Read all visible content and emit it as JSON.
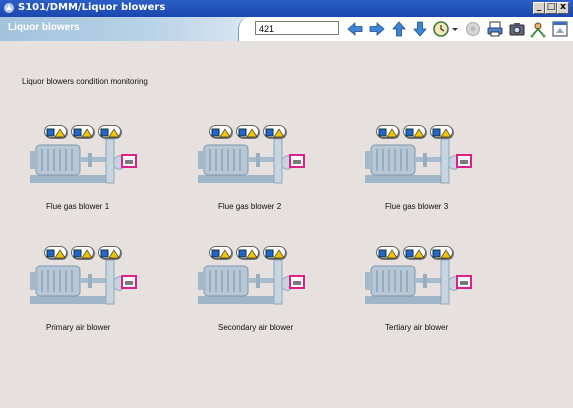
{
  "window": {
    "title": "S101/DMM/Liquor blowers"
  },
  "toolbar": {
    "page_name": "Liquor blowers",
    "number_value": "421"
  },
  "page": {
    "heading": "Liquor blowers condition monitoring"
  },
  "blowers": [
    {
      "label": "Flue gas blower 1"
    },
    {
      "label": "Flue gas blower 2"
    },
    {
      "label": "Flue gas blower 3"
    },
    {
      "label": "Primary air blower"
    },
    {
      "label": "Secondary air blower"
    },
    {
      "label": "Tertiary air blower"
    }
  ],
  "icons": {
    "toolbar": [
      "arrow-left-icon",
      "arrow-right-icon",
      "arrow-up-icon",
      "arrow-down-icon",
      "history-icon",
      "disabled-tool-icon",
      "print-icon",
      "camera-icon",
      "network-icon",
      "window-icon"
    ],
    "status": [
      "info-icon",
      "warning-icon"
    ],
    "machine": "blower-motor-icon",
    "sensor": "sensor-icon"
  },
  "colors": {
    "warning": "#f2c400",
    "sensor_border": "#e0208a",
    "info_blue": "#2266cc",
    "titlebar": "#1f4fb8"
  }
}
